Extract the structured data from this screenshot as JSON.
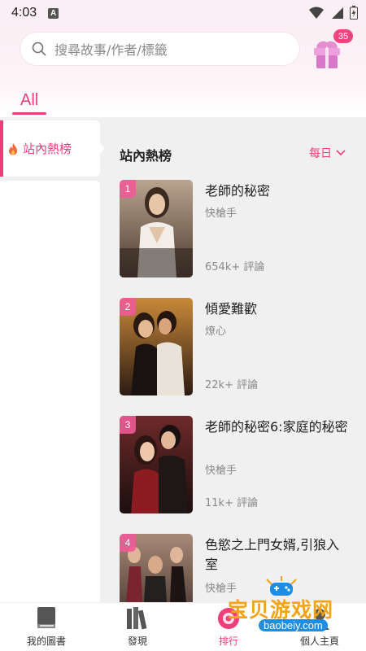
{
  "status_bar": {
    "time": "4:03",
    "indicator": "A"
  },
  "search": {
    "placeholder": "搜尋故事/作者/標籤"
  },
  "gift": {
    "badge_count": "35"
  },
  "tabs": {
    "active": "All"
  },
  "sidebar": {
    "items": [
      {
        "label": "站內熱榜",
        "icon": "fire-icon",
        "active": true
      }
    ]
  },
  "ranking": {
    "title": "站內熱榜",
    "period": "每日",
    "books": [
      {
        "rank": "1",
        "title": "老師的秘密",
        "author": "快槍手",
        "comments": "654k+ 評論"
      },
      {
        "rank": "2",
        "title": "傾愛難歡",
        "author": "燎心",
        "comments": "22k+ 評論"
      },
      {
        "rank": "3",
        "title": "老師的秘密6:家庭的秘密",
        "author": "快槍手",
        "comments": "11k+ 評論"
      },
      {
        "rank": "4",
        "title": "色慾之上門女婿,引狼入室",
        "author": "快槍手",
        "comments": ""
      }
    ]
  },
  "bottom_nav": {
    "items": [
      {
        "label": "我的圖書",
        "icon": "bookshelf-icon"
      },
      {
        "label": "發現",
        "icon": "books-icon"
      },
      {
        "label": "排行",
        "icon": "ranking-icon",
        "active": true
      },
      {
        "label": "個人主頁",
        "icon": "profile-icon"
      }
    ]
  },
  "watermark": {
    "title": "宝贝游戏网",
    "url": "baobeiy.com"
  },
  "colors": {
    "accent": "#ee3f78",
    "sidebar_bg": "#f0f0f0",
    "header_tint": "#fbeef4",
    "watermark_orange": "#f5a316",
    "watermark_blue": "#1c8ee6"
  }
}
